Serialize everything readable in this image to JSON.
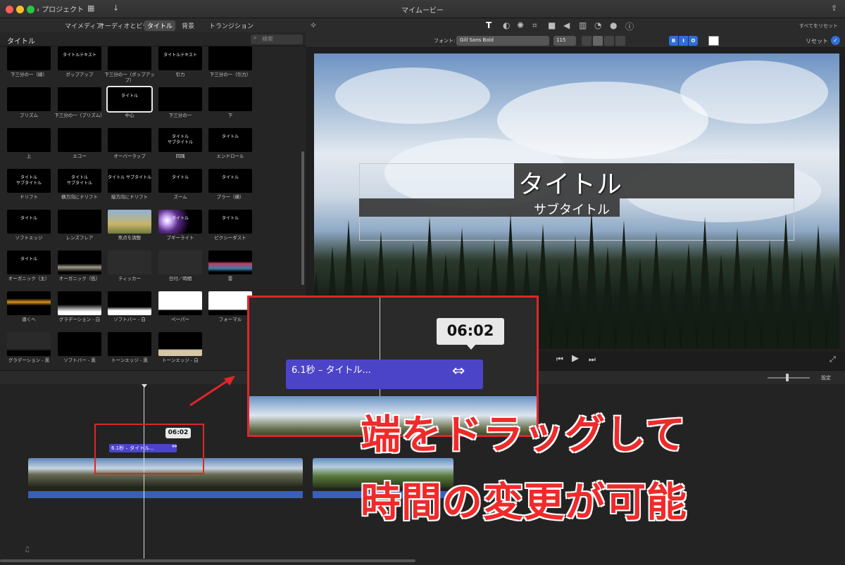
{
  "window": {
    "title": "マイムービー",
    "back_label": "プロジェクト"
  },
  "browser_tabs": [
    {
      "label": "マイメディア"
    },
    {
      "label": "オーディオとビデオ"
    },
    {
      "label": "タイトル"
    },
    {
      "label": "背景"
    },
    {
      "label": "トランジション"
    }
  ],
  "library": {
    "title": "タイトル",
    "search_placeholder": "検索",
    "tiles": [
      {
        "caption": "下三分の一（線）",
        "text": ""
      },
      {
        "caption": "ポップアップ",
        "text": "タイトルテキスト"
      },
      {
        "caption": "下三分の一（ポップアップ）",
        "text": ""
      },
      {
        "caption": "引力",
        "text": "タイトルテキスト"
      },
      {
        "caption": "下三分の一（引力）",
        "text": ""
      },
      {
        "caption": "プリズム",
        "text": ""
      },
      {
        "caption": "下三分の一（プリズム）",
        "text": ""
      },
      {
        "caption": "中心",
        "text": "タイトル"
      },
      {
        "caption": "下三分の一",
        "text": ""
      },
      {
        "caption": "下",
        "text": ""
      },
      {
        "caption": "上",
        "text": ""
      },
      {
        "caption": "エコー",
        "text": ""
      },
      {
        "caption": "オーバーラップ",
        "text": ""
      },
      {
        "caption": "四隅",
        "text": "タイトル\nサブタイトル"
      },
      {
        "caption": "エンドロール",
        "text": "タイトル"
      },
      {
        "caption": "ドリフト",
        "text": "タイトル\nサブタイトル"
      },
      {
        "caption": "横方向にドリフト",
        "text": "タイトル\nサブタイトル"
      },
      {
        "caption": "縦方向にドリフト",
        "text": "タイトル サブタイトル"
      },
      {
        "caption": "ズーム",
        "text": "タイトル"
      },
      {
        "caption": "ブラー（横）",
        "text": "タイトル"
      },
      {
        "caption": "ソフトエッジ",
        "text": "タイトル"
      },
      {
        "caption": "レンズフレア",
        "text": ""
      },
      {
        "caption": "焦点を調整",
        "text": ""
      },
      {
        "caption": "ブギーライト",
        "text": "タイトル"
      },
      {
        "caption": "ピクシーダスト",
        "text": "タイトル"
      },
      {
        "caption": "オーガニック（主）",
        "text": "タイトル"
      },
      {
        "caption": "オーガニック（低）",
        "text": ""
      },
      {
        "caption": "ティッカー",
        "text": ""
      },
      {
        "caption": "日付／時間",
        "text": ""
      },
      {
        "caption": "雲",
        "text": ""
      },
      {
        "caption": "遠くへ",
        "text": ""
      },
      {
        "caption": "グラデーション - 白",
        "text": ""
      },
      {
        "caption": "ソフトバー - 白",
        "text": ""
      },
      {
        "caption": "ペーパー",
        "text": ""
      },
      {
        "caption": "フォーマル",
        "text": ""
      },
      {
        "caption": "グラデーション - 黒",
        "text": ""
      },
      {
        "caption": "ソフトバー - 黒",
        "text": ""
      },
      {
        "caption": "トーンエッジ - 黒",
        "text": ""
      },
      {
        "caption": "トーンエッジ - 白",
        "text": ""
      }
    ]
  },
  "viewer_toolbar": {
    "reset_all": "すべてをリセット"
  },
  "font_bar": {
    "font_label": "フォント:",
    "font_value": "Gill Sans Bold",
    "size_value": "115",
    "bold": "B",
    "italic": "I",
    "outline": "O",
    "reset_label": "リセット",
    "accent": "#2f6fd6"
  },
  "viewer": {
    "title": "タイトル",
    "subtitle": "サブタイトル"
  },
  "timeline": {
    "settings_label": "設定",
    "title_clip_label": "6.1秒 – タイトル...",
    "time_tooltip": "06:02"
  },
  "zoom": {
    "clip_label": "6.1秒 – タイトル...",
    "time_tooltip": "06:02"
  },
  "annotation": {
    "line1": "端をドラッグして",
    "line2": "時間の変更が可能",
    "color": "#f02a2a"
  }
}
